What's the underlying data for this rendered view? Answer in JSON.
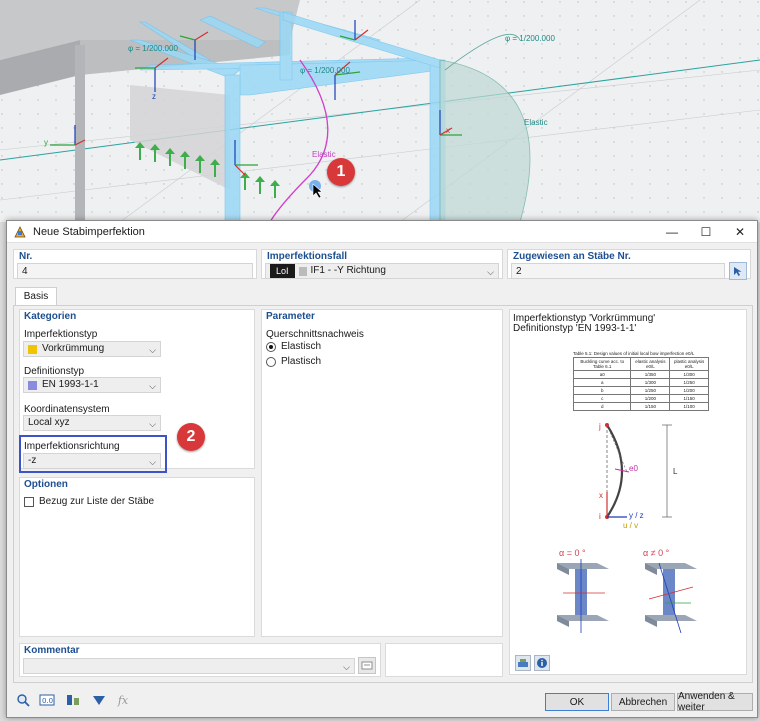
{
  "viewport": {
    "labels": {
      "ratio1": "φ = 1/200.000",
      "ratio2": "φ = 1/200.000",
      "ratio3": "φ = 1/200.000",
      "elastic1": "Elastic",
      "elastic2": "Elastic"
    },
    "axes": {
      "x": "x",
      "y": "y",
      "z": "z"
    },
    "badge1": "1"
  },
  "dialog": {
    "title": "Neue Stabimperfektion",
    "fields": {
      "nr_label": "Nr.",
      "nr_value": "4",
      "case_label": "Imperfektionsfall",
      "case_tag": "LoI",
      "case_value": "IF1 - -Y Richtung",
      "assigned_label": "Zugewiesen an Stäbe Nr.",
      "assigned_value": "2"
    },
    "tab": "Basis",
    "kategorien": {
      "header": "Kategorien",
      "imp_type_label": "Imperfektionstyp",
      "imp_type_value": "Vorkrümmung",
      "imp_type_color": "#f0c400",
      "def_type_label": "Definitionstyp",
      "def_type_value": "EN 1993-1-1",
      "def_type_color": "#8a8adf",
      "coord_label": "Koordinatensystem",
      "coord_value": "Local xyz",
      "dir_label": "Imperfektionsrichtung",
      "dir_value": "-z"
    },
    "badge2": "2",
    "optionen": {
      "header": "Optionen",
      "checkbox_label": "Bezug zur Liste der Stäbe"
    },
    "parameter": {
      "header": "Parameter",
      "group_label": "Querschnittsnachweis",
      "radio1": "Elastisch",
      "radio2": "Plastisch"
    },
    "info": {
      "line1": "Imperfektionstyp 'Vorkrümmung'",
      "line2": "Definitionstyp 'EN 1993-1-1'",
      "table_title": "Table 5.1: Design values of initial local bow imperfection e0/L",
      "table_headers": [
        "Buckling curve acc. to Table 6.1",
        "elastic analysis e0/L",
        "plastic analysis e0/L"
      ],
      "table_rows": [
        [
          "a0",
          "1/350",
          "1/300"
        ],
        [
          "a",
          "1/300",
          "1/250"
        ],
        [
          "b",
          "1/250",
          "1/200"
        ],
        [
          "c",
          "1/200",
          "1/150"
        ],
        [
          "d",
          "1/150",
          "1/100"
        ]
      ],
      "diagram": {
        "j": "j",
        "i": "i",
        "x": "x",
        "e0": "e0",
        "L": "L",
        "yz": "y / z",
        "uv": "u / v"
      },
      "alpha1": "α = 0 °",
      "alpha2": "α ≠ 0 °"
    },
    "kommentar": {
      "header": "Kommentar"
    },
    "buttons": {
      "ok": "OK",
      "cancel": "Abbrechen",
      "apply": "Anwenden & weiter"
    }
  }
}
